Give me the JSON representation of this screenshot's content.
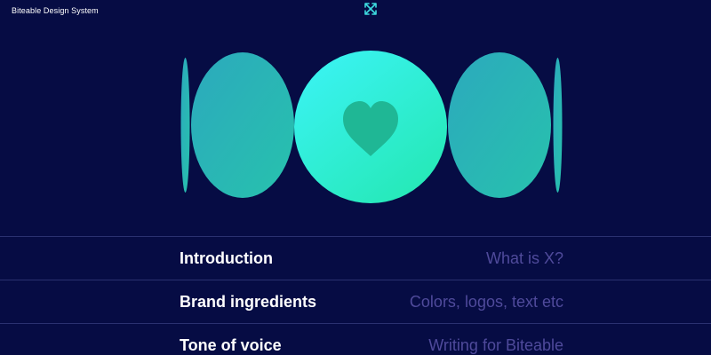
{
  "header": {
    "title": "Biteable Design System",
    "expand_icon": "expand-arrows-icon"
  },
  "hero": {
    "icon": "heart-icon",
    "colors": {
      "background": "#060c44",
      "side_circle_start": "#2db5b8",
      "side_circle_end": "#26cfb0",
      "center_circle_start": "#37f0ef",
      "center_circle_end": "#28eab8",
      "heart": "#1fb795",
      "accent": "#3ddbe0"
    }
  },
  "nav": {
    "items": [
      {
        "title": "Introduction",
        "description": "What is X?"
      },
      {
        "title": "Brand ingredients",
        "description": "Colors, logos, text etc"
      },
      {
        "title": "Tone of voice",
        "description": "Writing for Biteable"
      }
    ]
  }
}
